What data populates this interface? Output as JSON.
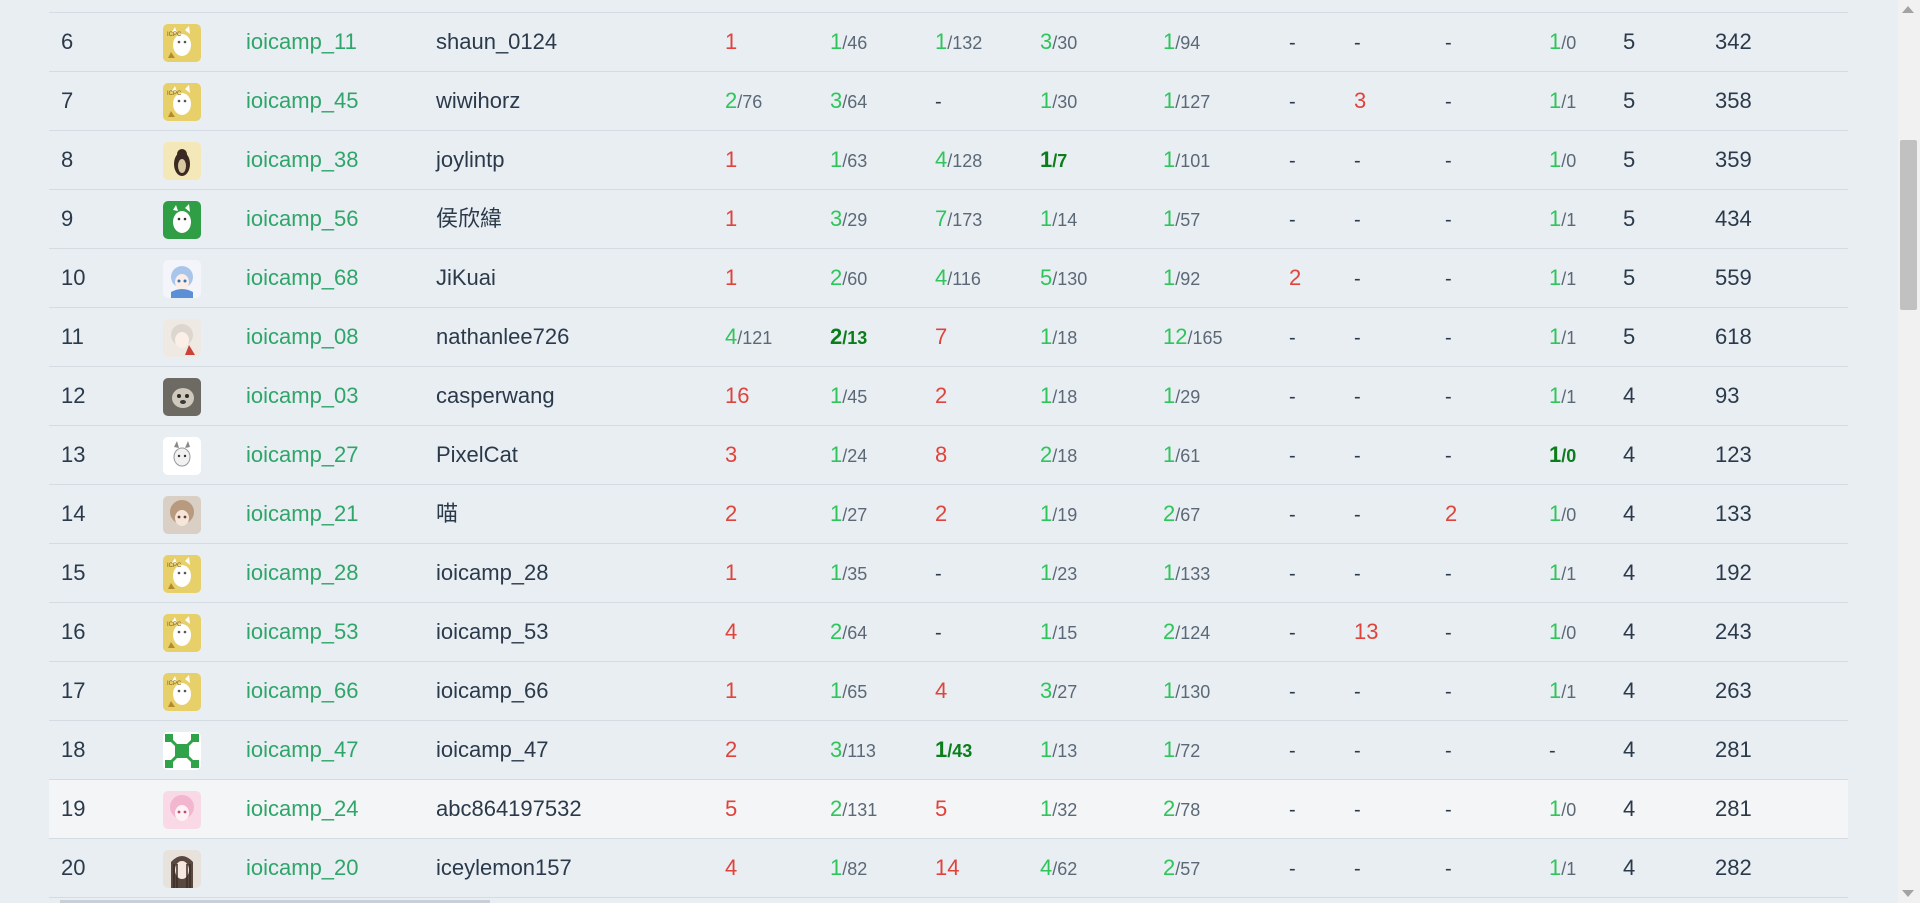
{
  "rows": [
    {
      "rank": "6",
      "avatar": "cat-yellow",
      "handle": "ioicamp_11",
      "nick": "shaun_0124",
      "problems": [
        {
          "s": "wa",
          "c": "1",
          "t": ""
        },
        {
          "s": "ac",
          "c": "1",
          "t": "/46"
        },
        {
          "s": "ac",
          "c": "1",
          "t": "/132"
        },
        {
          "s": "ac",
          "c": "3",
          "t": "/30"
        },
        {
          "s": "ac",
          "c": "1",
          "t": "/94"
        },
        {
          "s": "none",
          "c": "-",
          "t": ""
        },
        {
          "s": "none",
          "c": "-",
          "t": ""
        },
        {
          "s": "none",
          "c": "-",
          "t": ""
        },
        {
          "s": "ac",
          "c": "1",
          "t": "/0"
        }
      ],
      "solved": "5",
      "penalty": "342"
    },
    {
      "rank": "7",
      "avatar": "cat-yellow",
      "handle": "ioicamp_45",
      "nick": "wiwihorz",
      "problems": [
        {
          "s": "ac",
          "c": "2",
          "t": "/76"
        },
        {
          "s": "ac",
          "c": "3",
          "t": "/64"
        },
        {
          "s": "none",
          "c": "-",
          "t": ""
        },
        {
          "s": "ac",
          "c": "1",
          "t": "/30"
        },
        {
          "s": "ac",
          "c": "1",
          "t": "/127"
        },
        {
          "s": "none",
          "c": "-",
          "t": ""
        },
        {
          "s": "wa",
          "c": "3",
          "t": ""
        },
        {
          "s": "none",
          "c": "-",
          "t": ""
        },
        {
          "s": "ac",
          "c": "1",
          "t": "/1"
        }
      ],
      "solved": "5",
      "penalty": "358"
    },
    {
      "rank": "8",
      "avatar": "penguin",
      "handle": "ioicamp_38",
      "nick": "joylintp",
      "problems": [
        {
          "s": "wa",
          "c": "1",
          "t": ""
        },
        {
          "s": "ac",
          "c": "1",
          "t": "/63"
        },
        {
          "s": "ac",
          "c": "4",
          "t": "/128"
        },
        {
          "s": "first",
          "c": "1",
          "t": "/7"
        },
        {
          "s": "ac",
          "c": "1",
          "t": "/101"
        },
        {
          "s": "none",
          "c": "-",
          "t": ""
        },
        {
          "s": "none",
          "c": "-",
          "t": ""
        },
        {
          "s": "none",
          "c": "-",
          "t": ""
        },
        {
          "s": "ac",
          "c": "1",
          "t": "/0"
        }
      ],
      "solved": "5",
      "penalty": "359"
    },
    {
      "rank": "9",
      "avatar": "cat-green",
      "handle": "ioicamp_56",
      "nick": "侯欣緯",
      "problems": [
        {
          "s": "wa",
          "c": "1",
          "t": ""
        },
        {
          "s": "ac",
          "c": "3",
          "t": "/29"
        },
        {
          "s": "ac",
          "c": "7",
          "t": "/173"
        },
        {
          "s": "ac",
          "c": "1",
          "t": "/14"
        },
        {
          "s": "ac",
          "c": "1",
          "t": "/57"
        },
        {
          "s": "none",
          "c": "-",
          "t": ""
        },
        {
          "s": "none",
          "c": "-",
          "t": ""
        },
        {
          "s": "none",
          "c": "-",
          "t": ""
        },
        {
          "s": "ac",
          "c": "1",
          "t": "/1"
        }
      ],
      "solved": "5",
      "penalty": "434"
    },
    {
      "rank": "10",
      "avatar": "anime-blue",
      "handle": "ioicamp_68",
      "nick": "JiKuai",
      "problems": [
        {
          "s": "wa",
          "c": "1",
          "t": ""
        },
        {
          "s": "ac",
          "c": "2",
          "t": "/60"
        },
        {
          "s": "ac",
          "c": "4",
          "t": "/116"
        },
        {
          "s": "ac",
          "c": "5",
          "t": "/130"
        },
        {
          "s": "ac",
          "c": "1",
          "t": "/92"
        },
        {
          "s": "wa",
          "c": "2",
          "t": ""
        },
        {
          "s": "none",
          "c": "-",
          "t": ""
        },
        {
          "s": "none",
          "c": "-",
          "t": ""
        },
        {
          "s": "ac",
          "c": "1",
          "t": "/1"
        }
      ],
      "solved": "5",
      "penalty": "559"
    },
    {
      "rank": "11",
      "avatar": "anime-white",
      "handle": "ioicamp_08",
      "nick": "nathanlee726",
      "problems": [
        {
          "s": "ac",
          "c": "4",
          "t": "/121"
        },
        {
          "s": "first",
          "c": "2",
          "t": "/13"
        },
        {
          "s": "wa",
          "c": "7",
          "t": ""
        },
        {
          "s": "ac",
          "c": "1",
          "t": "/18"
        },
        {
          "s": "ac",
          "c": "12",
          "t": "/165"
        },
        {
          "s": "none",
          "c": "-",
          "t": ""
        },
        {
          "s": "none",
          "c": "-",
          "t": ""
        },
        {
          "s": "none",
          "c": "-",
          "t": ""
        },
        {
          "s": "ac",
          "c": "1",
          "t": "/1"
        }
      ],
      "solved": "5",
      "penalty": "618"
    },
    {
      "rank": "12",
      "avatar": "photo-dog",
      "handle": "ioicamp_03",
      "nick": "casperwang",
      "problems": [
        {
          "s": "wa",
          "c": "16",
          "t": ""
        },
        {
          "s": "ac",
          "c": "1",
          "t": "/45"
        },
        {
          "s": "wa",
          "c": "2",
          "t": ""
        },
        {
          "s": "ac",
          "c": "1",
          "t": "/18"
        },
        {
          "s": "ac",
          "c": "1",
          "t": "/29"
        },
        {
          "s": "none",
          "c": "-",
          "t": ""
        },
        {
          "s": "none",
          "c": "-",
          "t": ""
        },
        {
          "s": "none",
          "c": "-",
          "t": ""
        },
        {
          "s": "ac",
          "c": "1",
          "t": "/1"
        }
      ],
      "solved": "4",
      "penalty": "93"
    },
    {
      "rank": "13",
      "avatar": "cat-white",
      "handle": "ioicamp_27",
      "nick": "PixelCat",
      "problems": [
        {
          "s": "wa",
          "c": "3",
          "t": ""
        },
        {
          "s": "ac",
          "c": "1",
          "t": "/24"
        },
        {
          "s": "wa",
          "c": "8",
          "t": ""
        },
        {
          "s": "ac",
          "c": "2",
          "t": "/18"
        },
        {
          "s": "ac",
          "c": "1",
          "t": "/61"
        },
        {
          "s": "none",
          "c": "-",
          "t": ""
        },
        {
          "s": "none",
          "c": "-",
          "t": ""
        },
        {
          "s": "none",
          "c": "-",
          "t": ""
        },
        {
          "s": "first",
          "c": "1",
          "t": "/0"
        }
      ],
      "solved": "4",
      "penalty": "123"
    },
    {
      "rank": "14",
      "avatar": "anime-pale",
      "handle": "ioicamp_21",
      "nick": "喵",
      "problems": [
        {
          "s": "wa",
          "c": "2",
          "t": ""
        },
        {
          "s": "ac",
          "c": "1",
          "t": "/27"
        },
        {
          "s": "wa",
          "c": "2",
          "t": ""
        },
        {
          "s": "ac",
          "c": "1",
          "t": "/19"
        },
        {
          "s": "ac",
          "c": "2",
          "t": "/67"
        },
        {
          "s": "none",
          "c": "-",
          "t": ""
        },
        {
          "s": "none",
          "c": "-",
          "t": ""
        },
        {
          "s": "wa",
          "c": "2",
          "t": ""
        },
        {
          "s": "ac",
          "c": "1",
          "t": "/0"
        }
      ],
      "solved": "4",
      "penalty": "133"
    },
    {
      "rank": "15",
      "avatar": "cat-yellow",
      "handle": "ioicamp_28",
      "nick": "ioicamp_28",
      "problems": [
        {
          "s": "wa",
          "c": "1",
          "t": ""
        },
        {
          "s": "ac",
          "c": "1",
          "t": "/35"
        },
        {
          "s": "none",
          "c": "-",
          "t": ""
        },
        {
          "s": "ac",
          "c": "1",
          "t": "/23"
        },
        {
          "s": "ac",
          "c": "1",
          "t": "/133"
        },
        {
          "s": "none",
          "c": "-",
          "t": ""
        },
        {
          "s": "none",
          "c": "-",
          "t": ""
        },
        {
          "s": "none",
          "c": "-",
          "t": ""
        },
        {
          "s": "ac",
          "c": "1",
          "t": "/1"
        }
      ],
      "solved": "4",
      "penalty": "192"
    },
    {
      "rank": "16",
      "avatar": "cat-yellow",
      "handle": "ioicamp_53",
      "nick": "ioicamp_53",
      "problems": [
        {
          "s": "wa",
          "c": "4",
          "t": ""
        },
        {
          "s": "ac",
          "c": "2",
          "t": "/64"
        },
        {
          "s": "none",
          "c": "-",
          "t": ""
        },
        {
          "s": "ac",
          "c": "1",
          "t": "/15"
        },
        {
          "s": "ac",
          "c": "2",
          "t": "/124"
        },
        {
          "s": "none",
          "c": "-",
          "t": ""
        },
        {
          "s": "wa",
          "c": "13",
          "t": ""
        },
        {
          "s": "none",
          "c": "-",
          "t": ""
        },
        {
          "s": "ac",
          "c": "1",
          "t": "/0"
        }
      ],
      "solved": "4",
      "penalty": "243"
    },
    {
      "rank": "17",
      "avatar": "cat-yellow",
      "handle": "ioicamp_66",
      "nick": "ioicamp_66",
      "problems": [
        {
          "s": "wa",
          "c": "1",
          "t": ""
        },
        {
          "s": "ac",
          "c": "1",
          "t": "/65"
        },
        {
          "s": "wa",
          "c": "4",
          "t": ""
        },
        {
          "s": "ac",
          "c": "3",
          "t": "/27"
        },
        {
          "s": "ac",
          "c": "1",
          "t": "/130"
        },
        {
          "s": "none",
          "c": "-",
          "t": ""
        },
        {
          "s": "none",
          "c": "-",
          "t": ""
        },
        {
          "s": "none",
          "c": "-",
          "t": ""
        },
        {
          "s": "ac",
          "c": "1",
          "t": "/1"
        }
      ],
      "solved": "4",
      "penalty": "263"
    },
    {
      "rank": "18",
      "avatar": "pattern-green",
      "handle": "ioicamp_47",
      "nick": "ioicamp_47",
      "problems": [
        {
          "s": "wa",
          "c": "2",
          "t": ""
        },
        {
          "s": "ac",
          "c": "3",
          "t": "/113"
        },
        {
          "s": "first",
          "c": "1",
          "t": "/43"
        },
        {
          "s": "ac",
          "c": "1",
          "t": "/13"
        },
        {
          "s": "ac",
          "c": "1",
          "t": "/72"
        },
        {
          "s": "none",
          "c": "-",
          "t": ""
        },
        {
          "s": "none",
          "c": "-",
          "t": ""
        },
        {
          "s": "none",
          "c": "-",
          "t": ""
        },
        {
          "s": "none",
          "c": "-",
          "t": ""
        }
      ],
      "solved": "4",
      "penalty": "281"
    },
    {
      "rank": "19",
      "avatar": "anime-pink",
      "handle": "ioicamp_24",
      "nick": "abc864197532",
      "highlight": true,
      "problems": [
        {
          "s": "wa",
          "c": "5",
          "t": ""
        },
        {
          "s": "ac",
          "c": "2",
          "t": "/131"
        },
        {
          "s": "wa",
          "c": "5",
          "t": ""
        },
        {
          "s": "ac",
          "c": "1",
          "t": "/32"
        },
        {
          "s": "ac",
          "c": "2",
          "t": "/78"
        },
        {
          "s": "none",
          "c": "-",
          "t": ""
        },
        {
          "s": "none",
          "c": "-",
          "t": ""
        },
        {
          "s": "none",
          "c": "-",
          "t": ""
        },
        {
          "s": "ac",
          "c": "1",
          "t": "/0"
        }
      ],
      "solved": "4",
      "penalty": "281"
    },
    {
      "rank": "20",
      "avatar": "anime-dark",
      "handle": "ioicamp_20",
      "nick": "iceylemon157",
      "problems": [
        {
          "s": "wa",
          "c": "4",
          "t": ""
        },
        {
          "s": "ac",
          "c": "1",
          "t": "/82"
        },
        {
          "s": "wa",
          "c": "14",
          "t": ""
        },
        {
          "s": "ac",
          "c": "4",
          "t": "/62"
        },
        {
          "s": "ac",
          "c": "2",
          "t": "/57"
        },
        {
          "s": "none",
          "c": "-",
          "t": ""
        },
        {
          "s": "none",
          "c": "-",
          "t": ""
        },
        {
          "s": "none",
          "c": "-",
          "t": ""
        },
        {
          "s": "ac",
          "c": "1",
          "t": "/1"
        }
      ],
      "solved": "4",
      "penalty": "282"
    }
  ],
  "colors": {
    "accepted": "#2ec55a",
    "first_solve": "#0b7d1c",
    "wrong": "#e0433b",
    "handle_link": "#2fa56a",
    "background": "#e9eef3"
  }
}
